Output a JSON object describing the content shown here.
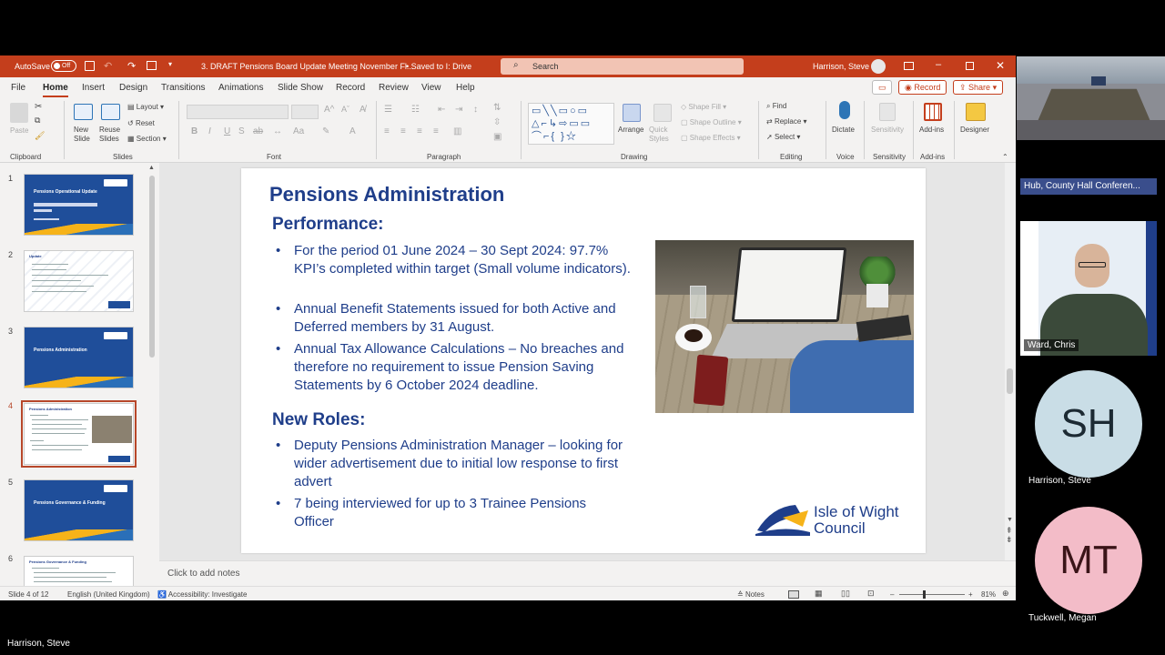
{
  "titlebar": {
    "autosave_label": "AutoSave",
    "autosave_state": "Off",
    "doc_title": "3. DRAFT Pensions Board Update Meeting November Fl...",
    "saved_status": "• Saved to I: Drive",
    "search_placeholder": "Search",
    "user_name": "Harrison, Steve"
  },
  "menu": {
    "items": [
      "File",
      "Home",
      "Insert",
      "Design",
      "Transitions",
      "Animations",
      "Slide Show",
      "Record",
      "Review",
      "View",
      "Help"
    ],
    "record_button": "Record",
    "share_button": "Share"
  },
  "ribbon": {
    "clipboard": {
      "label": "Clipboard",
      "paste": "Paste"
    },
    "slides": {
      "label": "Slides",
      "new_slide": "New Slide",
      "reuse_slides": "Reuse Slides",
      "layout": "Layout",
      "reset": "Reset",
      "section": "Section"
    },
    "font": {
      "label": "Font"
    },
    "paragraph": {
      "label": "Paragraph"
    },
    "drawing": {
      "label": "Drawing",
      "arrange": "Arrange",
      "quick_styles": "Quick Styles",
      "shape_fill": "Shape Fill",
      "shape_outline": "Shape Outline",
      "shape_effects": "Shape Effects"
    },
    "editing": {
      "label": "Editing",
      "find": "Find",
      "replace": "Replace",
      "select": "Select"
    },
    "voice": {
      "label": "Voice",
      "dictate": "Dictate"
    },
    "sensitivity": {
      "label": "Sensitivity",
      "button": "Sensitivity"
    },
    "addins": {
      "label": "Add-ins",
      "button": "Add-ins"
    },
    "designer": {
      "button": "Designer"
    }
  },
  "thumbnails": [
    {
      "num": "1",
      "title": "Pensions Operational Update"
    },
    {
      "num": "2",
      "title": "Update"
    },
    {
      "num": "3",
      "title": "Pensions Administration"
    },
    {
      "num": "4",
      "title": "Pensions Administration"
    },
    {
      "num": "5",
      "title": "Pensions Governance & Funding"
    },
    {
      "num": "6",
      "title": "Pensions Governance & Funding"
    }
  ],
  "slide": {
    "title": "Pensions Administration",
    "performance_heading": "Performance:",
    "performance_bullets": [
      "For the period 01 June 2024 – 30 Sept 2024: 97.7% KPI’s completed within target (Small volume indicators).",
      "Annual Benefit Statements issued for both Active and Deferred members by 31 August.",
      "Annual Tax Allowance Calculations – No breaches and therefore no requirement to issue Pension Saving Statements by 6 October 2024 deadline."
    ],
    "new_roles_heading": "New Roles:",
    "new_roles_bullets": [
      "Deputy Pensions Administration Manager – looking for wider advertisement due to initial low response to first advert",
      "7 being interviewed for up to 3 Trainee Pensions Officer"
    ],
    "logo_line1": "Isle of Wight",
    "logo_line2": "Council"
  },
  "notes_placeholder": "Click to add notes",
  "status": {
    "slide_count": "Slide 4 of 12",
    "language": "English (United Kingdom)",
    "accessibility": "Accessibility: Investigate",
    "notes": "Notes",
    "zoom": "81%"
  },
  "video": {
    "room_label": "Hub, County Hall Conferen...",
    "participant1": "Ward, Chris",
    "participant2_initials": "SH",
    "participant2": "Harrison, Steve",
    "participant3_initials": "MT",
    "participant3": "Tuckwell, Megan",
    "presenter": "Harrison, Steve"
  },
  "colors": {
    "accent": "#c43e1c",
    "slide_blue": "#1f3e8a",
    "sh_avatar": "#c9dde6",
    "mt_avatar": "#f3bcc8"
  }
}
